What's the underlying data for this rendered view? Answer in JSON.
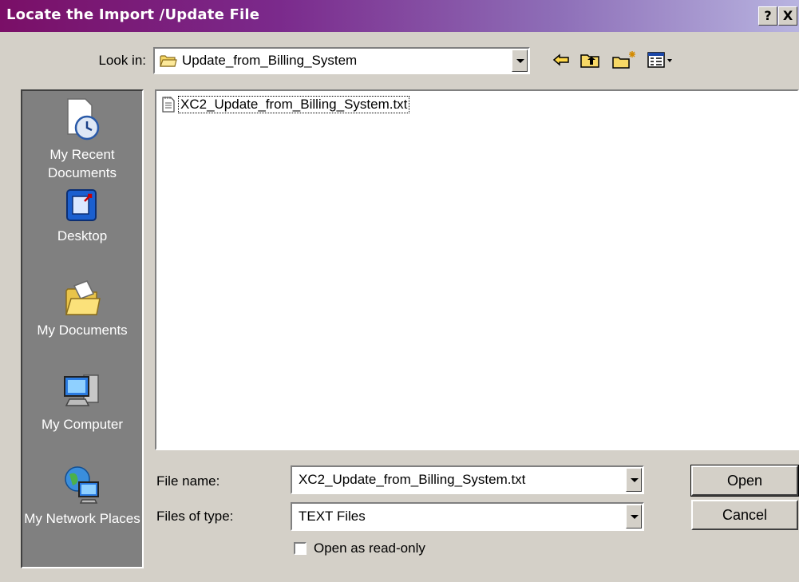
{
  "window": {
    "title": "Locate the Import /Update  File",
    "help_label": "?",
    "close_label": "X"
  },
  "lookin": {
    "label": "Look in:",
    "value": "Update_from_Billing_System"
  },
  "toolbar": {
    "icons": [
      "back-arrow-icon",
      "up-one-level-icon",
      "new-folder-icon",
      "view-menu-icon"
    ]
  },
  "places": [
    {
      "label": "My Recent Documents",
      "icon": "recent-documents-icon"
    },
    {
      "label": "Desktop",
      "icon": "desktop-icon"
    },
    {
      "label": "My Documents",
      "icon": "my-documents-icon"
    },
    {
      "label": "My Computer",
      "icon": "my-computer-icon"
    },
    {
      "label": "My Network Places",
      "icon": "network-places-icon"
    }
  ],
  "files": [
    {
      "name": "XC2_Update_from_Billing_System.txt",
      "icon": "text-file-icon"
    }
  ],
  "filename": {
    "label": "File name:",
    "value": "XC2_Update_from_Billing_System.txt"
  },
  "filetype": {
    "label": "Files of type:",
    "value": "TEXT Files"
  },
  "readonly": {
    "label": "Open as read-only",
    "checked": false
  },
  "buttons": {
    "open": "Open",
    "cancel": "Cancel"
  },
  "colors": {
    "titlebar_start": "#7a0f67",
    "titlebar_end": "#b8b4e0",
    "dialog_face": "#d4d0c8",
    "places_bg": "#808080"
  }
}
